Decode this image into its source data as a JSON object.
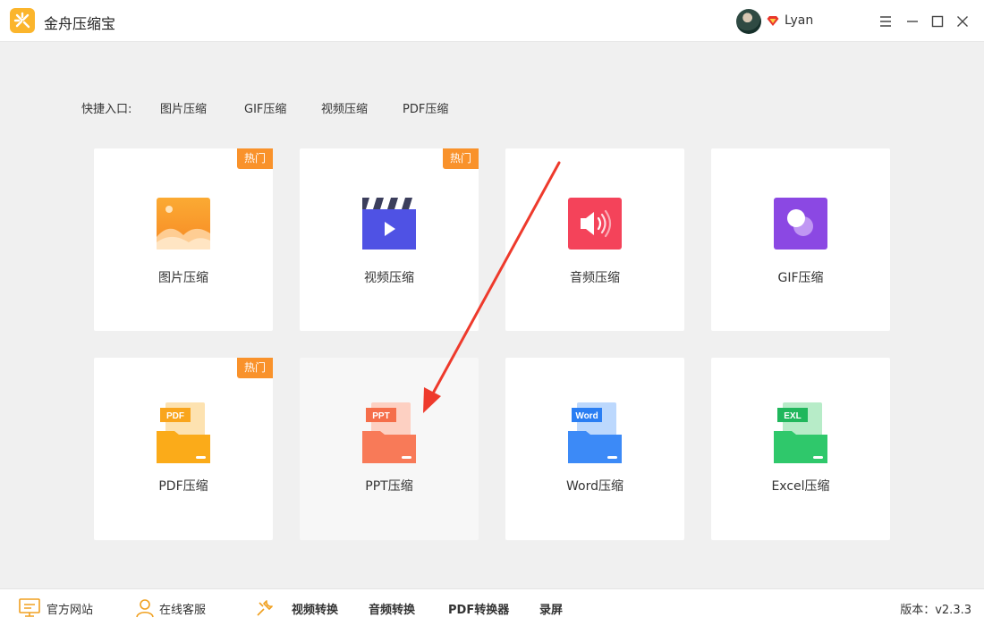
{
  "app": {
    "title": "金舟压缩宝",
    "logo_icon": "sparkle-logo-icon",
    "accent": "#fbb52c"
  },
  "user": {
    "name": "Lyan",
    "vip_icon": "vip-diamond-icon"
  },
  "window_controls": {
    "menu_icon": "hamburger-menu-icon",
    "minimize_icon": "minimize-icon",
    "maximize_icon": "maximize-icon",
    "close_icon": "close-icon"
  },
  "shortcuts": {
    "label": "快捷入口:",
    "links": [
      "图片压缩",
      "GIF压缩",
      "视频压缩",
      "PDF压缩"
    ]
  },
  "cards": [
    {
      "label": "图片压缩",
      "badge": "热门",
      "icon": "image-icon",
      "color": "#f99a2b"
    },
    {
      "label": "视频压缩",
      "badge": "热门",
      "icon": "video-clapper-icon",
      "color": "#4f52e4"
    },
    {
      "label": "音频压缩",
      "badge": "",
      "icon": "speaker-icon",
      "color": "#f4435a"
    },
    {
      "label": "GIF压缩",
      "badge": "",
      "icon": "gif-bubble-icon",
      "color": "#8b48e3"
    },
    {
      "label": "PDF压缩",
      "badge": "热门",
      "icon": "pdf-folder-icon",
      "tag": "PDF",
      "color": "#fbab19"
    },
    {
      "label": "PPT压缩",
      "badge": "",
      "icon": "ppt-folder-icon",
      "tag": "PPT",
      "color": "#f87a58"
    },
    {
      "label": "Word压缩",
      "badge": "",
      "icon": "word-folder-icon",
      "tag": "Word",
      "color": "#3c8af7"
    },
    {
      "label": "Excel压缩",
      "badge": "",
      "icon": "excel-folder-icon",
      "tag": "EXL",
      "color": "#2fc86b"
    }
  ],
  "bottom_bar": {
    "official_site": "官方网站",
    "online_service": "在线客服",
    "video_convert": "视频转换",
    "audio_convert": "音频转换",
    "pdf_converter": "PDF转换器",
    "screen_record": "录屏",
    "version": "版本：v2.3.3"
  },
  "annotation": {
    "arrow_color": "#ee3a2c"
  }
}
